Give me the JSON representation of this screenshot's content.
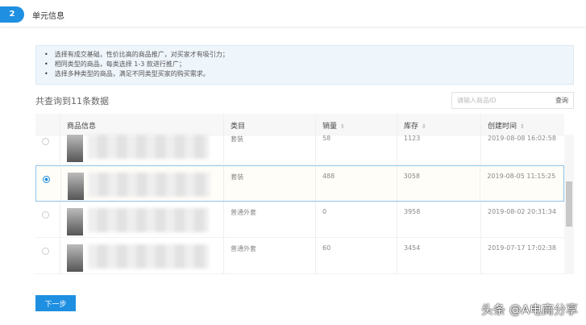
{
  "header": {
    "step": "2",
    "title": "单元信息"
  },
  "notice": [
    "选择有成交基础，性价比高的商品推广，对买家才有吸引力；",
    "相同类型的商品，每类选择 1-3 款进行推广；",
    "选择多种类型的商品，满足不同类型买家的购买需求。"
  ],
  "count_text": "共查询到11条数据",
  "search": {
    "placeholder": "请输入商品ID",
    "button": "查询"
  },
  "table": {
    "headers": [
      "商品信息",
      "类目",
      "销量",
      "库存",
      "创建时间"
    ],
    "rows": [
      {
        "category": "套装",
        "sales": "58",
        "stock": "1123",
        "created": "2019-08-08 16:02:58",
        "selected": false
      },
      {
        "category": "套装",
        "sales": "488",
        "stock": "3058",
        "created": "2019-08-05 11:15:25",
        "selected": true
      },
      {
        "category": "普通外套",
        "sales": "0",
        "stock": "3958",
        "created": "2019-08-02 20:31:34",
        "selected": false
      },
      {
        "category": "普通外套",
        "sales": "60",
        "stock": "3454",
        "created": "2019-07-17 17:02:38",
        "selected": false
      }
    ]
  },
  "next_button": "下一步",
  "watermark": "头条 @A电商分享"
}
